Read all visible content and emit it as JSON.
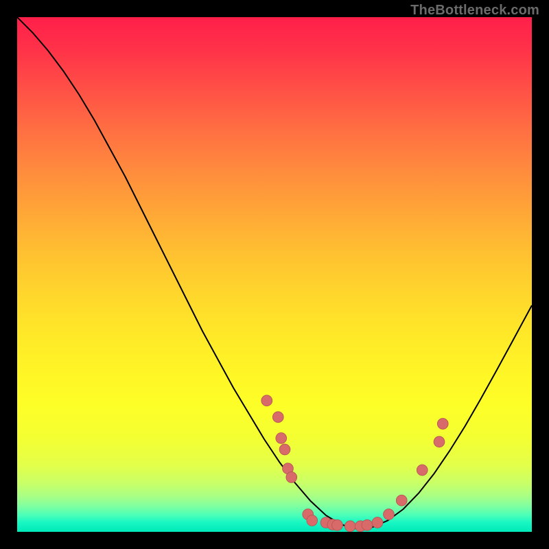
{
  "attribution": "TheBottleneck.com",
  "colors": {
    "page_bg": "#000000",
    "curve": "#000000",
    "marker_fill": "#d96a6a",
    "marker_stroke": "#b85656",
    "attribution_text": "#6b6b6b",
    "gradient_top": "#ff1f4a",
    "gradient_mid": "#ffe928",
    "gradient_bottom": "#00e8b9"
  },
  "chart_data": {
    "type": "line",
    "title": "",
    "xlabel": "",
    "ylabel": "",
    "xlim": [
      0,
      100
    ],
    "ylim": [
      0,
      100
    ],
    "grid": false,
    "legend": false,
    "series": [
      {
        "name": "bottleneck-curve",
        "x": [
          0,
          3,
          6,
          9,
          12,
          15,
          18,
          21,
          24,
          27,
          30,
          33,
          36,
          39,
          42,
          45,
          48,
          51,
          54,
          57,
          60,
          63,
          66,
          69,
          72,
          75,
          78,
          81,
          84,
          87,
          90,
          93,
          96,
          100
        ],
        "y": [
          100,
          97,
          93.5,
          89.5,
          85,
          80,
          74.5,
          69,
          63,
          57,
          51,
          45,
          39,
          33.5,
          28,
          23,
          18,
          13.5,
          9.5,
          6,
          3.2,
          1.4,
          0.6,
          0.9,
          2.2,
          4.4,
          7.5,
          11.3,
          15.7,
          20.5,
          25.7,
          31.1,
          36.6,
          44
        ]
      }
    ],
    "markers": [
      {
        "x": 48.5,
        "y": 25.5
      },
      {
        "x": 50.7,
        "y": 22.3
      },
      {
        "x": 51.3,
        "y": 18.2
      },
      {
        "x": 52.0,
        "y": 16.0
      },
      {
        "x": 52.6,
        "y": 12.3
      },
      {
        "x": 53.3,
        "y": 10.6
      },
      {
        "x": 56.5,
        "y": 3.4
      },
      {
        "x": 57.3,
        "y": 2.2
      },
      {
        "x": 60.0,
        "y": 1.8
      },
      {
        "x": 61.3,
        "y": 1.4
      },
      {
        "x": 62.2,
        "y": 1.3
      },
      {
        "x": 64.7,
        "y": 1.1
      },
      {
        "x": 66.7,
        "y": 1.1
      },
      {
        "x": 68.0,
        "y": 1.3
      },
      {
        "x": 70.0,
        "y": 1.8
      },
      {
        "x": 72.2,
        "y": 3.4
      },
      {
        "x": 74.7,
        "y": 6.1
      },
      {
        "x": 78.7,
        "y": 12.0
      },
      {
        "x": 82.0,
        "y": 17.5
      },
      {
        "x": 82.7,
        "y": 21.0
      }
    ],
    "marker_radius": 1.05
  }
}
